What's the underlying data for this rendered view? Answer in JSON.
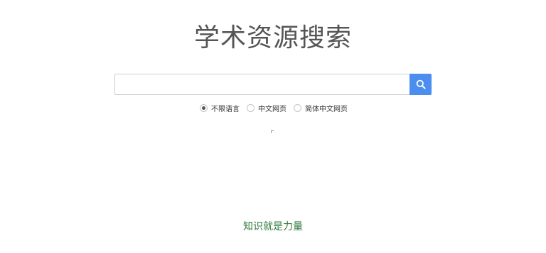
{
  "header": {
    "title": "学术资源搜索"
  },
  "search": {
    "value": "",
    "placeholder": "",
    "button_icon": "search-icon",
    "button_color": "#4b8ef0"
  },
  "language_filter": {
    "selected": "不限语言",
    "options": [
      {
        "label": "不限语言",
        "checked": true
      },
      {
        "label": "中文网页",
        "checked": false
      },
      {
        "label": "简体中文网页",
        "checked": false
      }
    ]
  },
  "footer": {
    "slogan": "知识就是力量",
    "color": "#2f7a3b"
  }
}
